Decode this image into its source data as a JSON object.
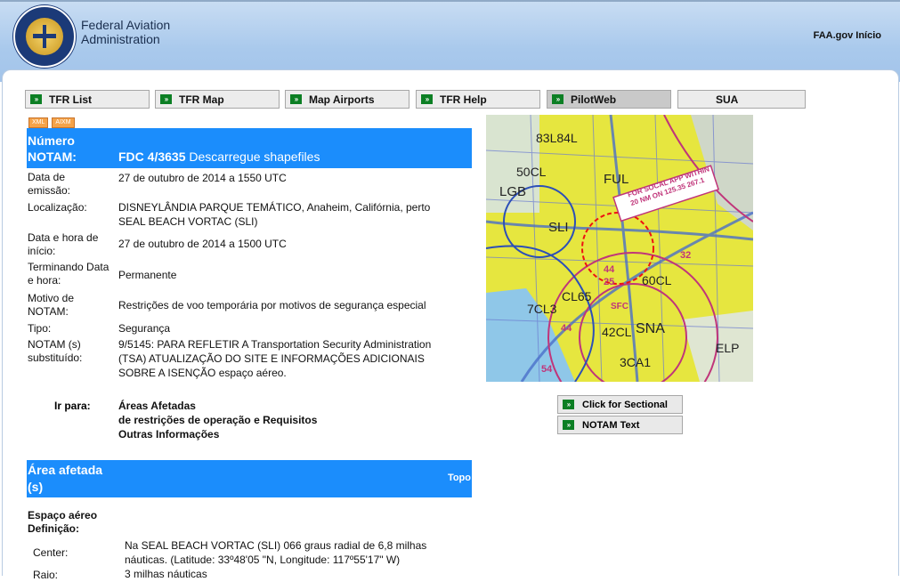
{
  "header": {
    "agency_line1": "Federal Aviation",
    "agency_line2": "Administration",
    "faa_link": "FAA.gov Início",
    "logo_icon": "faa-seal-icon"
  },
  "nav": {
    "items": [
      {
        "label": "TFR List"
      },
      {
        "label": "TFR Map"
      },
      {
        "label": "Map Airports"
      },
      {
        "label": "TFR Help"
      },
      {
        "label": "PilotWeb"
      },
      {
        "label": "SUA"
      }
    ],
    "active": "PilotWeb"
  },
  "badges": {
    "xml": "XML",
    "aixm": "AIXM"
  },
  "notam": {
    "number_label_1": "Número",
    "number_label_2": "NOTAM:",
    "number": "FDC 4/3635",
    "download_link": "Descarregue shapefiles",
    "fields": [
      {
        "label1": "Data de",
        "label2": "emissão:",
        "value": "27 de outubro de 2014 a 1550 UTC"
      },
      {
        "label1": "Localização:",
        "label2": "",
        "value": "DISNEYLÂNDIA PARQUE TEMÁTICO, Anaheim, Califórnia, perto",
        "value2": "SEAL BEACH VORTAC (SLI)"
      },
      {
        "label1": "Data e hora de",
        "label2": "início:",
        "value": "27 de outubro de 2014 a 1500 UTC"
      },
      {
        "label1": "Terminando Data",
        "label2": "e hora:",
        "value": "Permanente"
      },
      {
        "label1": "Motivo de",
        "label2": "NOTAM:",
        "value": "Restrições de voo temporária por motivos de segurança especial"
      },
      {
        "label1": "Tipo:",
        "label2": "",
        "value": "Segurança"
      },
      {
        "label1": "NOTAM (s)",
        "label2": "substituído:",
        "value": "9/5145: PARA REFLETIR A Transportation Security Administration",
        "value2": "(TSA) ATUALIZAÇÃO DO SITE E INFORMAÇÕES ADICIONAIS",
        "value3": "SOBRE A ISENÇÃO espaço aéreo."
      }
    ]
  },
  "goto": {
    "label": "Ir para:",
    "links": [
      "Áreas Afetadas",
      "de restrições de operação e Requisitos",
      "Outras Informações"
    ]
  },
  "area": {
    "title_1": "Área afetada",
    "title_2": "(s)",
    "top_link": "Topo",
    "airspace_label_1": "Espaço aéreo",
    "airspace_label_2": "Definição:",
    "center_label": "Center:",
    "center_value_1": "Na SEAL BEACH VORTAC (SLI) 066 graus radial de 6,8 milhas",
    "center_value_2": "náuticas. (Latitude: 33º48'05 \"N, Longitude: 117º55'17\" W)",
    "radius_label": "Raio:",
    "radius_value": "3 milhas náuticas"
  },
  "map": {
    "labels": [
      "83L84L",
      "FUL",
      "50CL",
      "LGB",
      "SLI",
      "CL65",
      "60CL",
      "7CL3",
      "42CL",
      "SNA",
      "3CA1",
      "ELP",
      "44",
      "25",
      "32",
      "54",
      "44",
      "SFC"
    ],
    "callout_line1": "FOR SOCAL APP WITHIN",
    "callout_line2": "20 NM ON 125.35 267.1"
  },
  "buttons": {
    "sectional": "Click for Sectional",
    "notam_text": "NOTAM Text"
  },
  "colors": {
    "accent_blue": "#1b8dfc",
    "header_blue": "#a9c9ec",
    "arrow_green": "#0c7f24"
  }
}
